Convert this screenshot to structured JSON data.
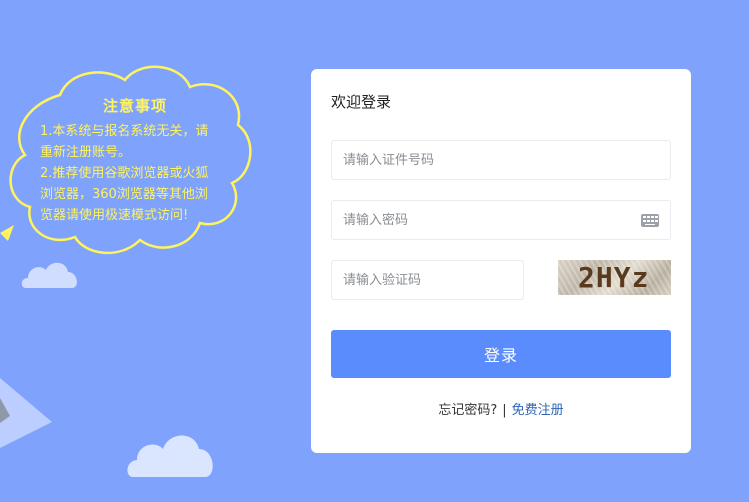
{
  "notice": {
    "title": "注意事项",
    "lines": [
      "1.本系统与报名系统无关，请",
      "重新注册账号。",
      "2.推荐使用谷歌浏览器或火狐",
      "浏览器，360浏览器等其他浏",
      "览器请使用极速模式访问!"
    ]
  },
  "login": {
    "title": "欢迎登录",
    "id_placeholder": "请输入证件号码",
    "password_placeholder": "请输入密码",
    "code_placeholder": "请输入验证码",
    "captcha_text": "2HYz",
    "submit_label": "登录",
    "forgot_label": "忘记密码?",
    "separator": "|",
    "register_label": "免费注册"
  },
  "colors": {
    "background": "#7fa2fc",
    "button": "#5b8cfd",
    "notice_text": "#fff35e",
    "link": "#2f64b5"
  },
  "icons": [
    "keyboard-icon"
  ]
}
